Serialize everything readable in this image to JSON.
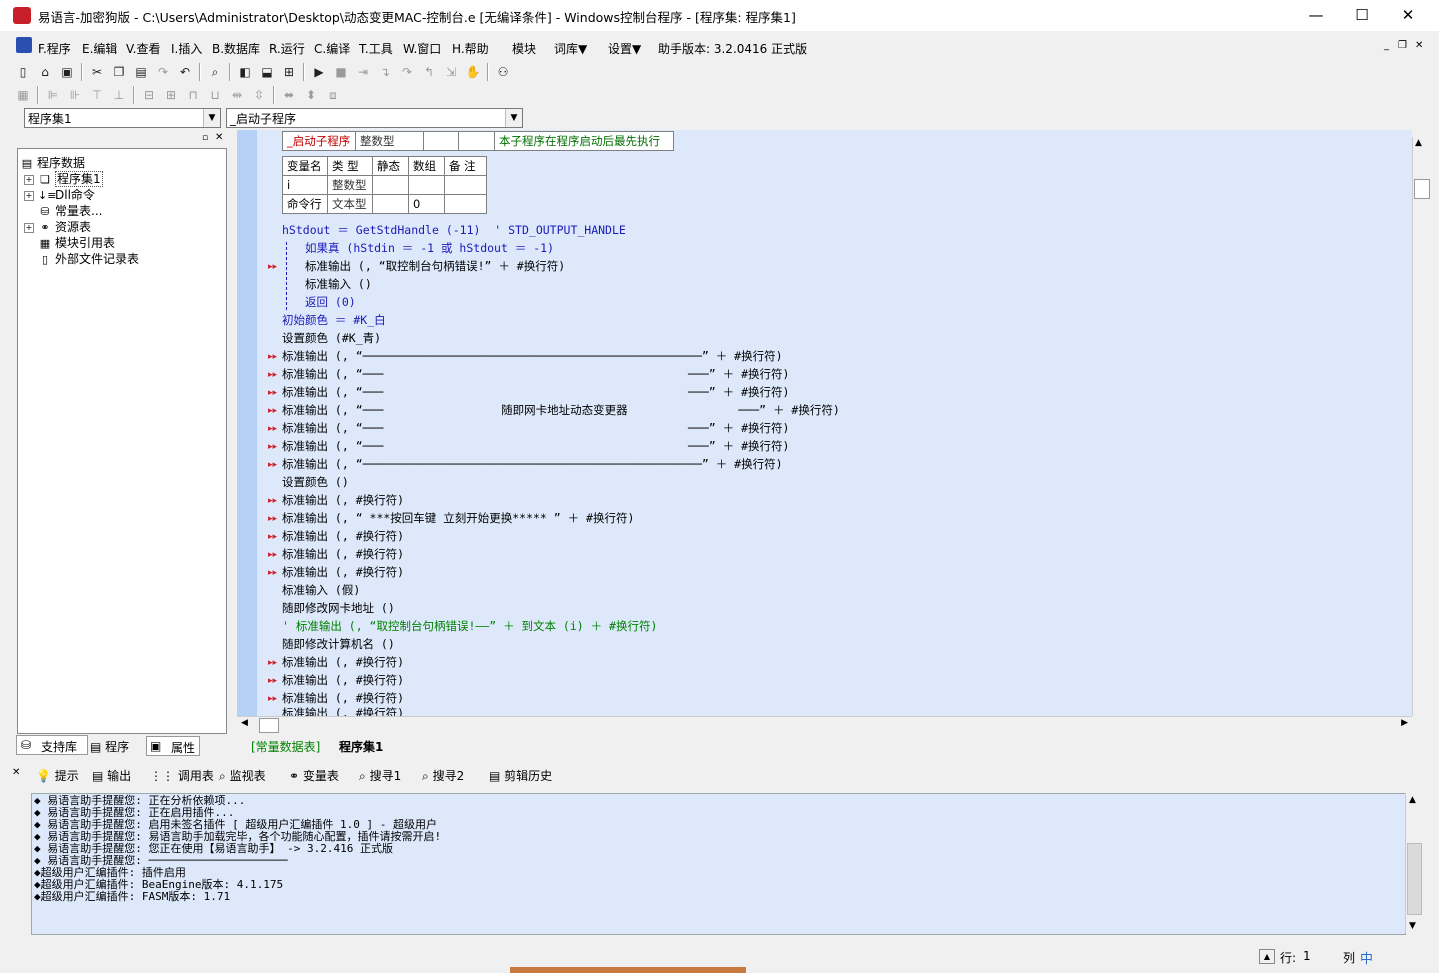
{
  "window": {
    "title": "易语言-加密狗版 - C:\\Users\\Administrator\\Desktop\\动态变更MAC-控制台.e [无编译条件] - Windows控制台程序 - [程序集: 程序集1]",
    "minimize": "—",
    "maximize": "☐",
    "close": "✕"
  },
  "menubar": {
    "items": [
      "F.程序",
      "E.编辑",
      "V.查看",
      "I.插入",
      "B.数据库",
      "R.运行",
      "C.编译",
      "T.工具",
      "W.窗口",
      "H.帮助",
      "模块",
      "词库▼",
      "设置▼"
    ],
    "version": "助手版本: 3.2.0416 正式版",
    "mdi": [
      "_",
      "❐",
      "✕"
    ]
  },
  "selectors": {
    "assembly": "程序集1",
    "subroutine": "_启动子程序"
  },
  "tree": {
    "root": "程序数据",
    "items": [
      "程序集1",
      "Dll命令",
      "常量表...",
      "资源表",
      "模块引用表",
      "外部文件记录表"
    ]
  },
  "left_tabs": [
    "支持库",
    "程序",
    "属性"
  ],
  "decl": {
    "name": "_启动子程序",
    "type": "整数型",
    "note": "本子程序在程序启动后最先执行",
    "headers": [
      "变量名",
      "类 型",
      "静态",
      "数组",
      "备 注"
    ],
    "vars": [
      {
        "name": "i",
        "type": "整数型",
        "static": "",
        "array": "",
        "note": ""
      },
      {
        "name": "命令行",
        "type": "文本型",
        "static": "",
        "array": "0",
        "note": ""
      }
    ]
  },
  "code_lines": [
    "hStdout ＝ GetStdHandle (-11)  ' STD_OUTPUT_HANDLE",
    "如果真 (hStdin ＝ -1 或 hStdout ＝ -1)",
    "标准输出 (, “取控制台句柄错误!” ＋ #换行符)",
    "标准输入 ()",
    "返回 (0)",
    "初始颜色 ＝ #K_白",
    "设置颜色 (#K_青)",
    "标准输出 (, “─────────────────────────────────────────────────” ＋ #换行符)",
    "标准输出 (, “───                                            ───” ＋ #换行符)",
    "标准输出 (, “───                                            ───” ＋ #换行符)",
    "标准输出 (, “───                 随即网卡地址动态变更器                ───” ＋ #换行符)",
    "标准输出 (, “───                                            ───” ＋ #换行符)",
    "标准输出 (, “───                                            ───” ＋ #换行符)",
    "标准输出 (, “─────────────────────────────────────────────────” ＋ #换行符)",
    "设置颜色 ()",
    "标准输出 (, #换行符)",
    "标准输出 (, “ ***按回车键 立刻开始更换***** ” ＋ #换行符)",
    "标准输出 (, #换行符)",
    "标准输出 (, #换行符)",
    "标准输出 (, #换行符)",
    "标准输入 (假)",
    "随即修改网卡地址 ()",
    "' 标准输出 (, “取控制台句柄错误!——” ＋ 到文本 (i) ＋ #换行符)",
    "随即修改计算机名 ()",
    "标准输出 (, #换行符)",
    "标准输出 (, #换行符)",
    "标准输出 (, #换行符)",
    "标准输出 (, #换行符)"
  ],
  "editor_tabs": [
    "[常量数据表]",
    "程序集1"
  ],
  "bottom_tabs": [
    "提示",
    "输出",
    "调用表",
    "监视表",
    "变量表",
    "搜寻1",
    "搜寻2",
    "剪辑历史"
  ],
  "output_lines": [
    "◆ 易语言助手提醒您: 正在分析依赖项...",
    "◆ 易语言助手提醒您: 正在启用插件...",
    "◆ 易语言助手提醒您: 启用未签名插件 [ 超级用户汇编插件 1.0 ] - 超级用户",
    "◆ 易语言助手提醒您: 易语言助手加载完毕，各个功能随心配置，插件请按需开启!",
    "◆ 易语言助手提醒您: 您正在使用【易语言助手】 -> 3.2.416 正式版",
    "◆ 易语言助手提醒您: ─────────────────────",
    "◆超级用户汇编插件: 插件启用",
    "◆超级用户汇编插件: BeaEngine版本: 4.1.175",
    "◆超级用户汇编插件: FASM版本: 1.71"
  ],
  "status": {
    "row_label": "行:",
    "row_value": "1",
    "col_label": "列",
    "ime": "中"
  }
}
